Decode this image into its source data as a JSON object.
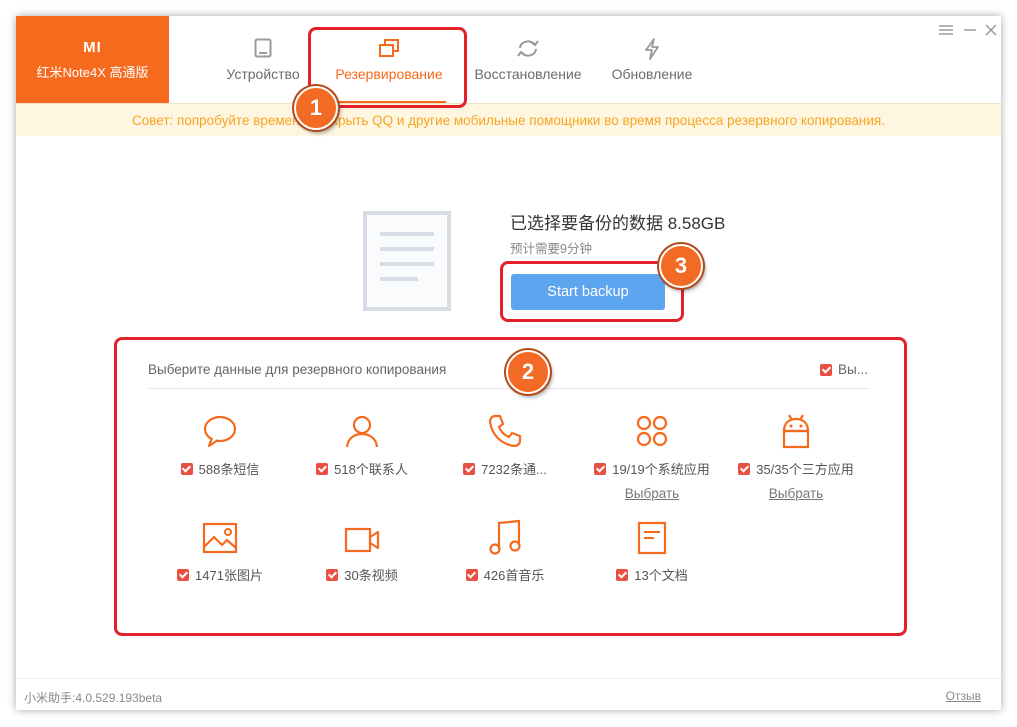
{
  "brand": {
    "logo": "MI",
    "device": "红米Note4X 高通版"
  },
  "nav": {
    "tabs": [
      {
        "label": "Устройство",
        "icon": "tablet-icon"
      },
      {
        "label": "Резервирование",
        "icon": "copy-icon",
        "active": true
      },
      {
        "label": "Восстановление",
        "icon": "refresh-icon"
      },
      {
        "label": "Обновление",
        "icon": "lightning-icon"
      }
    ]
  },
  "window_controls": [
    "menu-icon",
    "minimize-icon",
    "close-icon"
  ],
  "banner": {
    "text": "Совет: попробуйте временно закрыть QQ и другие мобильные помощники во время процесса резервного копирования."
  },
  "summary": {
    "title": "已选择要备份的数据 8.58GB",
    "subtitle": "预计需要9分钟",
    "button_label": "Start backup"
  },
  "data_section": {
    "title": "Выберите данные для резервного копирования",
    "select_all_label": "Вы...",
    "items": [
      {
        "label": "588条短信",
        "icon": "chat-bubble-icon",
        "checked": true
      },
      {
        "label": "518个联系人",
        "icon": "person-icon",
        "checked": true
      },
      {
        "label": "7232条通...",
        "icon": "phone-icon",
        "checked": true
      },
      {
        "label": "19/19个系统应用",
        "icon": "apps-grid-icon",
        "checked": true,
        "link": "Выбрать"
      },
      {
        "label": "35/35个三方应用",
        "icon": "android-icon",
        "checked": true,
        "link": "Выбрать"
      },
      {
        "label": "1471张图片",
        "icon": "image-icon",
        "checked": true
      },
      {
        "label": "30条视频",
        "icon": "video-camera-icon",
        "checked": true
      },
      {
        "label": "426首音乐",
        "icon": "music-note-icon",
        "checked": true
      },
      {
        "label": "13个文档",
        "icon": "document-icon",
        "checked": true
      }
    ]
  },
  "footer": {
    "version": "小米助手:4.0.529.193beta",
    "feedback": "Отзыв"
  },
  "annotations": {
    "badge1": "1",
    "badge2": "2",
    "badge3": "3"
  },
  "colors": {
    "accent": "#f56a1d",
    "button": "#5ea5f0",
    "banner_bg": "#fff6e1",
    "banner_text": "#f5a623",
    "checkbox": "#ea5041",
    "annotation": "#e4202b"
  }
}
